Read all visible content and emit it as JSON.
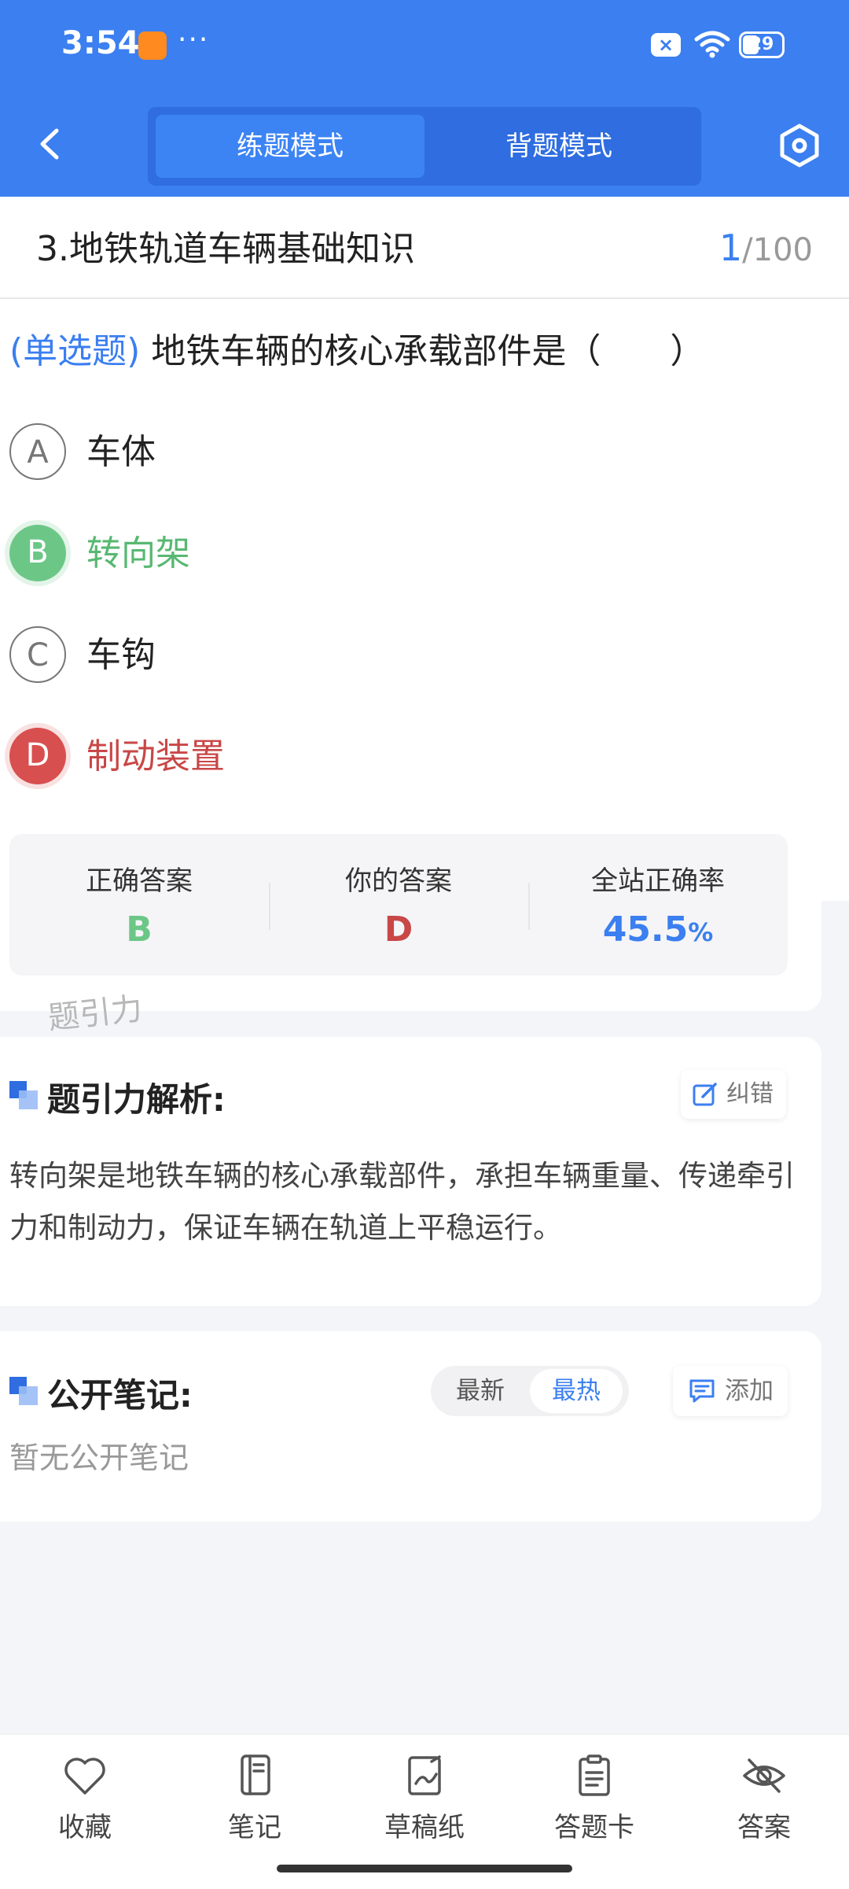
{
  "status_bar": {
    "time": "3:54",
    "dots": "···",
    "battery": "29"
  },
  "header": {
    "tabs": [
      {
        "label": "练题模式",
        "active": true
      },
      {
        "label": "背题模式",
        "active": false
      }
    ],
    "colors": {
      "primary": "#3b7ff0"
    }
  },
  "question": {
    "chapter": "3.地铁轨道车辆基础知识",
    "current": "1",
    "total": "/100",
    "type": "(单选题)",
    "text": "地铁车辆的核心承载部件是（　　）",
    "options": [
      {
        "letter": "A",
        "text": "车体",
        "state": "plain"
      },
      {
        "letter": "B",
        "text": "转向架",
        "state": "correct"
      },
      {
        "letter": "C",
        "text": "车钩",
        "state": "plain"
      },
      {
        "letter": "D",
        "text": "制动装置",
        "state": "wrong"
      }
    ]
  },
  "answer_summary": {
    "correct_title": "正确答案",
    "correct_value": "B",
    "yours_title": "你的答案",
    "yours_value": "D",
    "rate_title": "全站正确率",
    "rate_value": "45.5",
    "rate_unit": "%"
  },
  "watermark": "题引力",
  "analysis": {
    "title": "题引力解析:",
    "fix_label": "纠错",
    "text": "转向架是地铁车辆的核心承载部件，承担车辆重量、传递牵引力和制动力，保证车辆在轨道上平稳运行。"
  },
  "notes": {
    "title": "公开笔记:",
    "sort_options": [
      {
        "label": "最新",
        "active": false
      },
      {
        "label": "最热",
        "active": true
      }
    ],
    "add_label": "添加",
    "empty_text": "暂无公开笔记"
  },
  "bottom_bar": [
    {
      "label": "收藏",
      "icon": "heart-icon"
    },
    {
      "label": "笔记",
      "icon": "notebook-icon"
    },
    {
      "label": "草稿纸",
      "icon": "draft-paper-icon"
    },
    {
      "label": "答题卡",
      "icon": "answer-sheet-icon"
    },
    {
      "label": "答案",
      "icon": "eye-off-icon"
    }
  ]
}
